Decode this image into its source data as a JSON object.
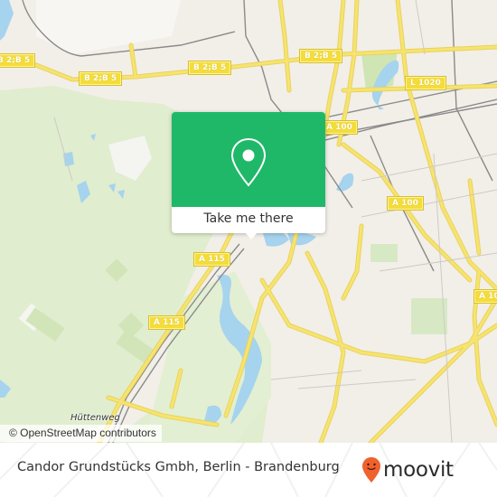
{
  "map": {
    "road_labels": [
      {
        "id": "b2b5-west",
        "text": "B 2;B 5"
      },
      {
        "id": "b2b5-mid",
        "text": "B 2;B 5"
      },
      {
        "id": "b2b5-center",
        "text": "B 2;B 5"
      },
      {
        "id": "b2b5-east",
        "text": "B 2;B 5"
      },
      {
        "id": "l1020",
        "text": "L 1020"
      },
      {
        "id": "a100-north",
        "text": "A 100"
      },
      {
        "id": "a100-mid",
        "text": "A 100"
      },
      {
        "id": "a100-east",
        "text": "A 10"
      },
      {
        "id": "a115-north",
        "text": "A 115"
      },
      {
        "id": "a115-south",
        "text": "A 115"
      }
    ],
    "place_labels": [
      {
        "id": "huttenweg",
        "text": "Hüttenweg"
      }
    ],
    "attribution": "© OpenStreetMap contributors",
    "colors": {
      "land": "#f2efe9",
      "forest": "#dfeccc",
      "water": "#a6d3ee",
      "road_major": "#f6e370",
      "railway": "#8a8a8a"
    }
  },
  "popup": {
    "icon": "location-pin-icon",
    "button_label": "Take me there",
    "color": "#1fb869"
  },
  "footer": {
    "place_title": "Candor Grundstücks Gmbh, Berlin - Brandenburg",
    "brand": {
      "name": "moovit",
      "icon": "moovit-smiley-pin-icon",
      "icon_color": "#f0612e"
    }
  }
}
